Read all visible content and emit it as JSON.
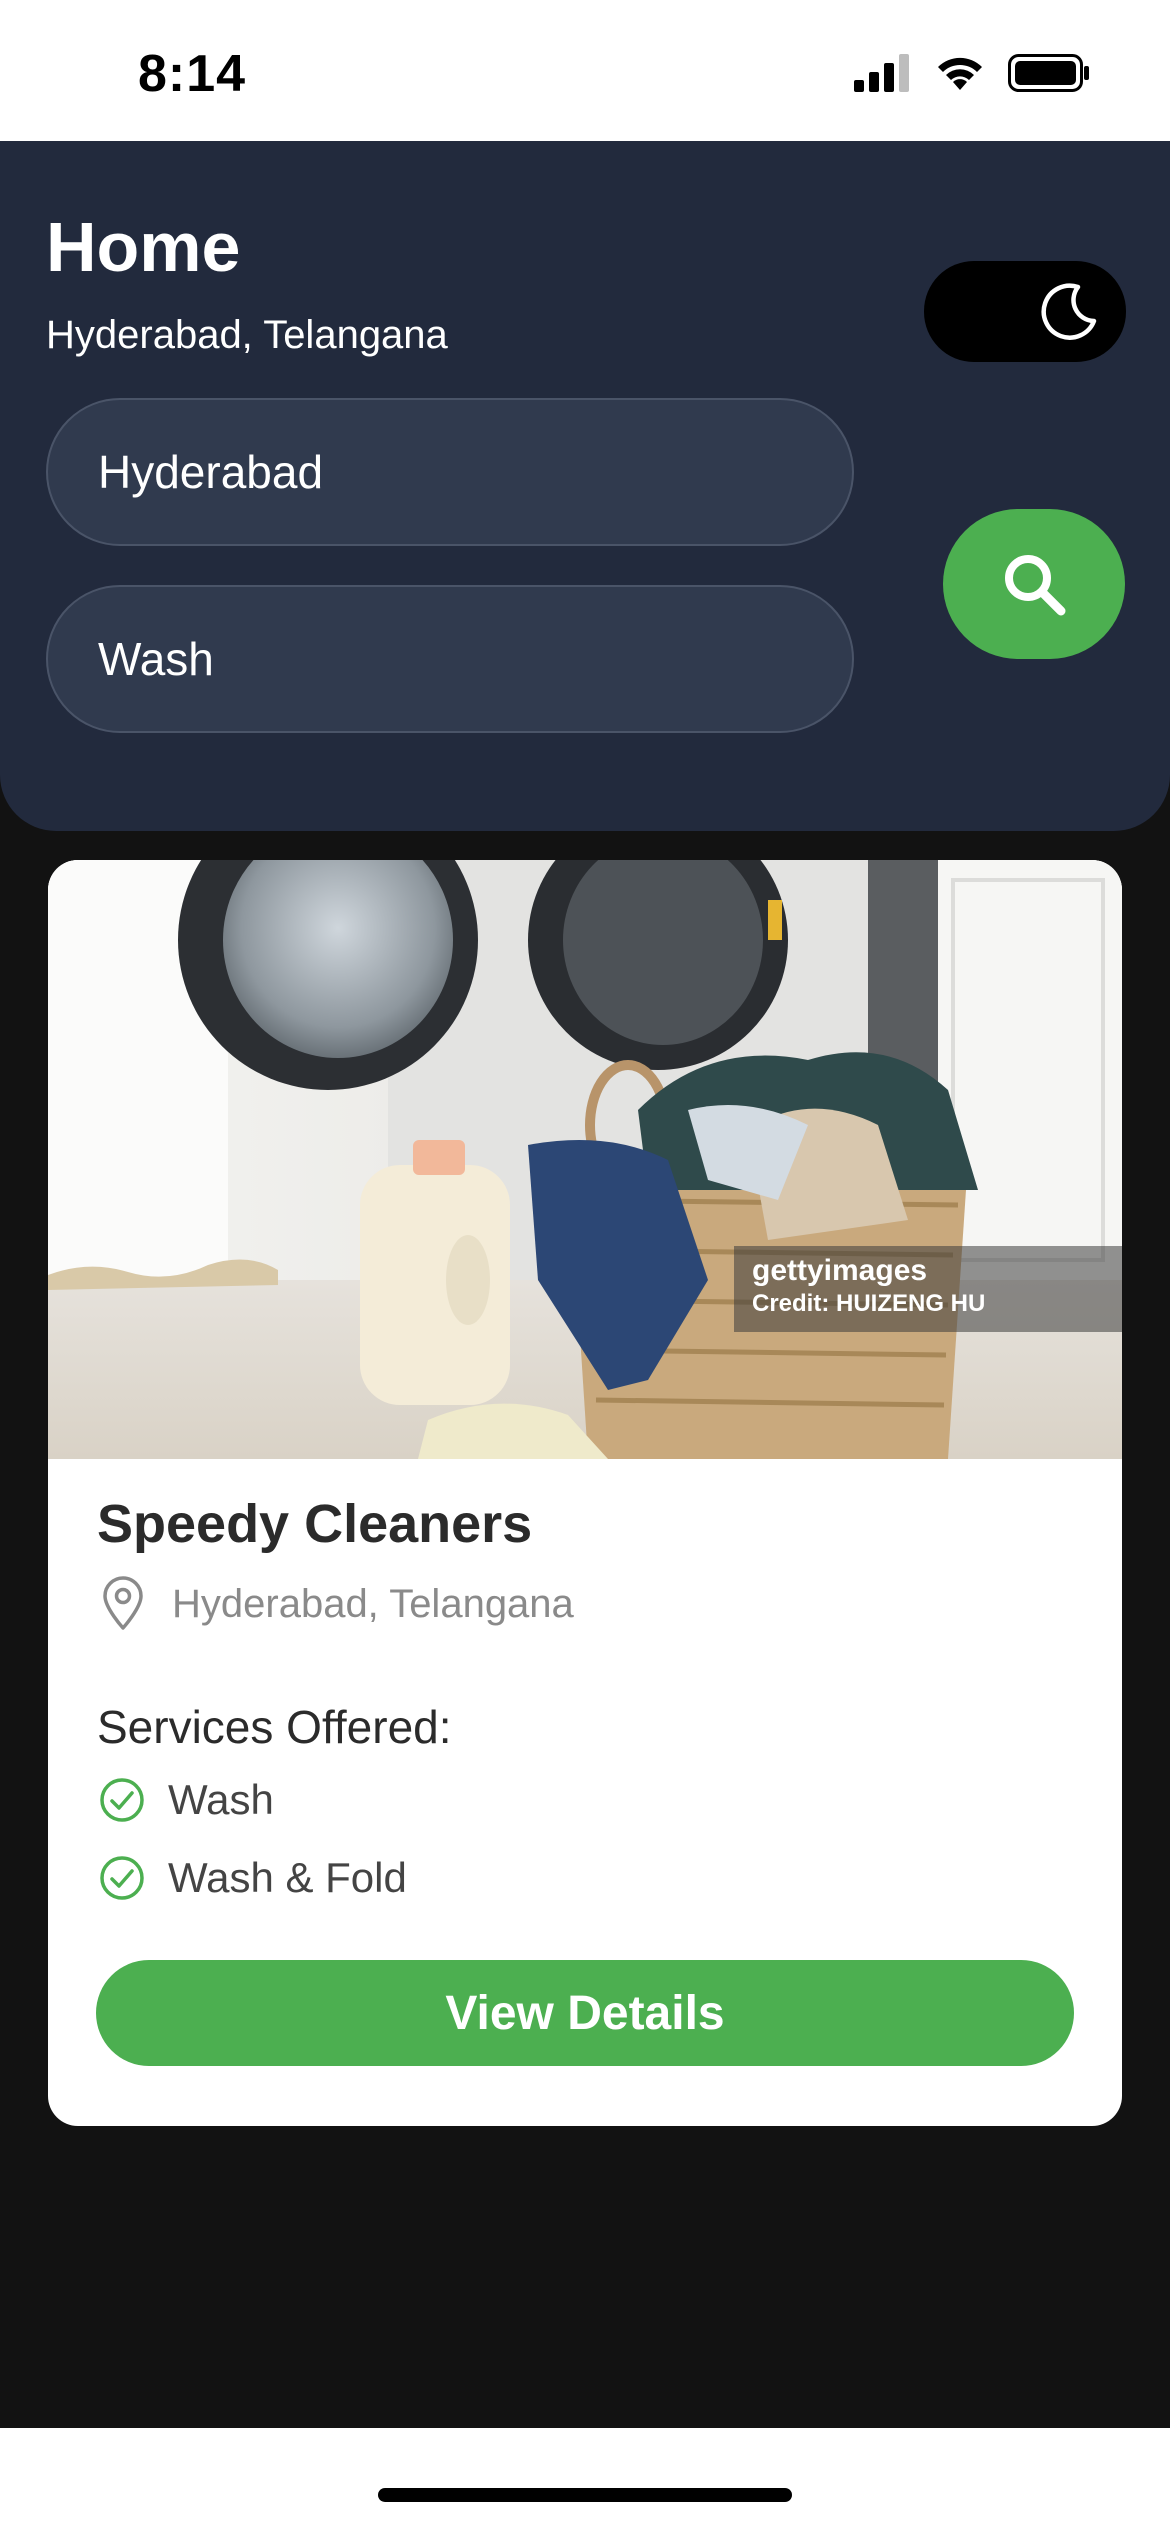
{
  "status_bar": {
    "time": "8:14",
    "icons": [
      "cellular-signal-icon",
      "wifi-icon",
      "battery-icon"
    ]
  },
  "header": {
    "title": "Home",
    "subtitle": "Hyderabad, Telangana",
    "theme_toggle_icon": "moon-icon",
    "location_input_value": "Hyderabad",
    "service_input_value": "Wash",
    "search_icon": "search-icon"
  },
  "card": {
    "image_icon": "laundry-photo",
    "watermark_brand": "gettyimages",
    "watermark_credit": "Credit: HUIZENG HU",
    "name": "Speedy Cleaners",
    "location": "Hyderabad, Telangana",
    "services_heading": "Services Offered:",
    "services": [
      "Wash",
      "Wash & Fold"
    ],
    "button_label": "View Details"
  },
  "colors": {
    "header_bg": "#222a3d",
    "accent": "#4caf50",
    "page_bg": "#121212",
    "card_bg": "#ffffff"
  }
}
